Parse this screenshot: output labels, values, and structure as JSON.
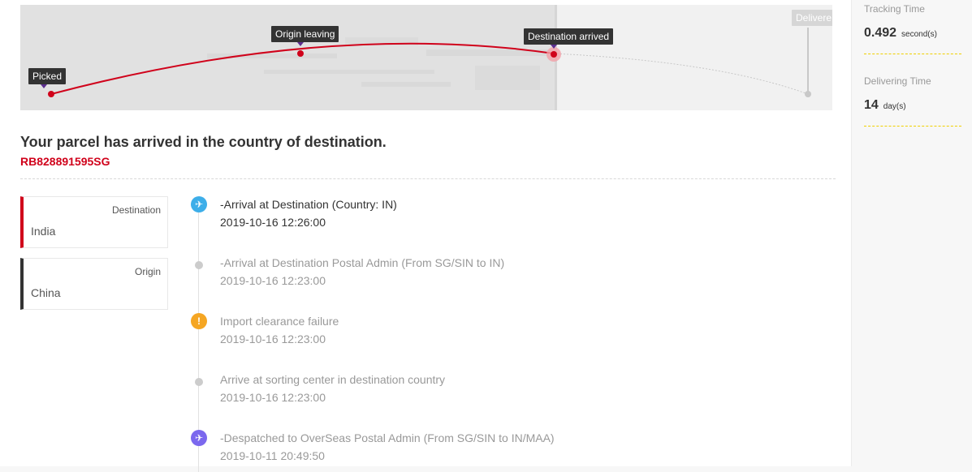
{
  "map": {
    "stops": [
      {
        "label": "Picked",
        "state": "done"
      },
      {
        "label": "Origin leaving",
        "state": "done"
      },
      {
        "label": "Destination arrived",
        "state": "current"
      },
      {
        "label": "Delivere",
        "state": "future"
      }
    ],
    "colors": {
      "route": "#d0021b",
      "future_route": "#c8c8c8",
      "tag": "#333333",
      "marker": "#5b2d8e"
    }
  },
  "parcel": {
    "status": "Your parcel has arrived in the country of destination.",
    "tracking_number": "RB828891595SG"
  },
  "countries": [
    {
      "role": "Destination",
      "name": "India"
    },
    {
      "role": "Origin",
      "name": "China"
    }
  ],
  "events": [
    {
      "title": "-Arrival at Destination (Country: IN)",
      "time": "2019-10-16 12:26:00",
      "icon": "airplane-landing-icon",
      "color": "#3daee9"
    },
    {
      "title": "-Arrival at Destination Postal Admin (From SG/SIN to IN)",
      "time": "2019-10-16 12:23:00",
      "icon": "dot-icon",
      "color": "#cccccc"
    },
    {
      "title": "Import clearance failure",
      "time": "2019-10-16 12:23:00",
      "icon": "alert-icon",
      "color": "#f5a623"
    },
    {
      "title": "Arrive at sorting center in destination country",
      "time": "2019-10-16 12:23:00",
      "icon": "dot-icon",
      "color": "#cccccc"
    },
    {
      "title": "-Despatched to OverSeas Postal Admin (From SG/SIN to IN/MAA)",
      "time": "2019-10-11 20:49:50",
      "icon": "airplane-takeoff-icon",
      "color": "#7b68ee"
    }
  ],
  "sidebar": {
    "tracking_time": {
      "label": "Tracking Time",
      "value": "0.492",
      "unit": "second(s)"
    },
    "delivering_time": {
      "label": "Delivering Time",
      "value": "14",
      "unit": "day(s)"
    }
  }
}
